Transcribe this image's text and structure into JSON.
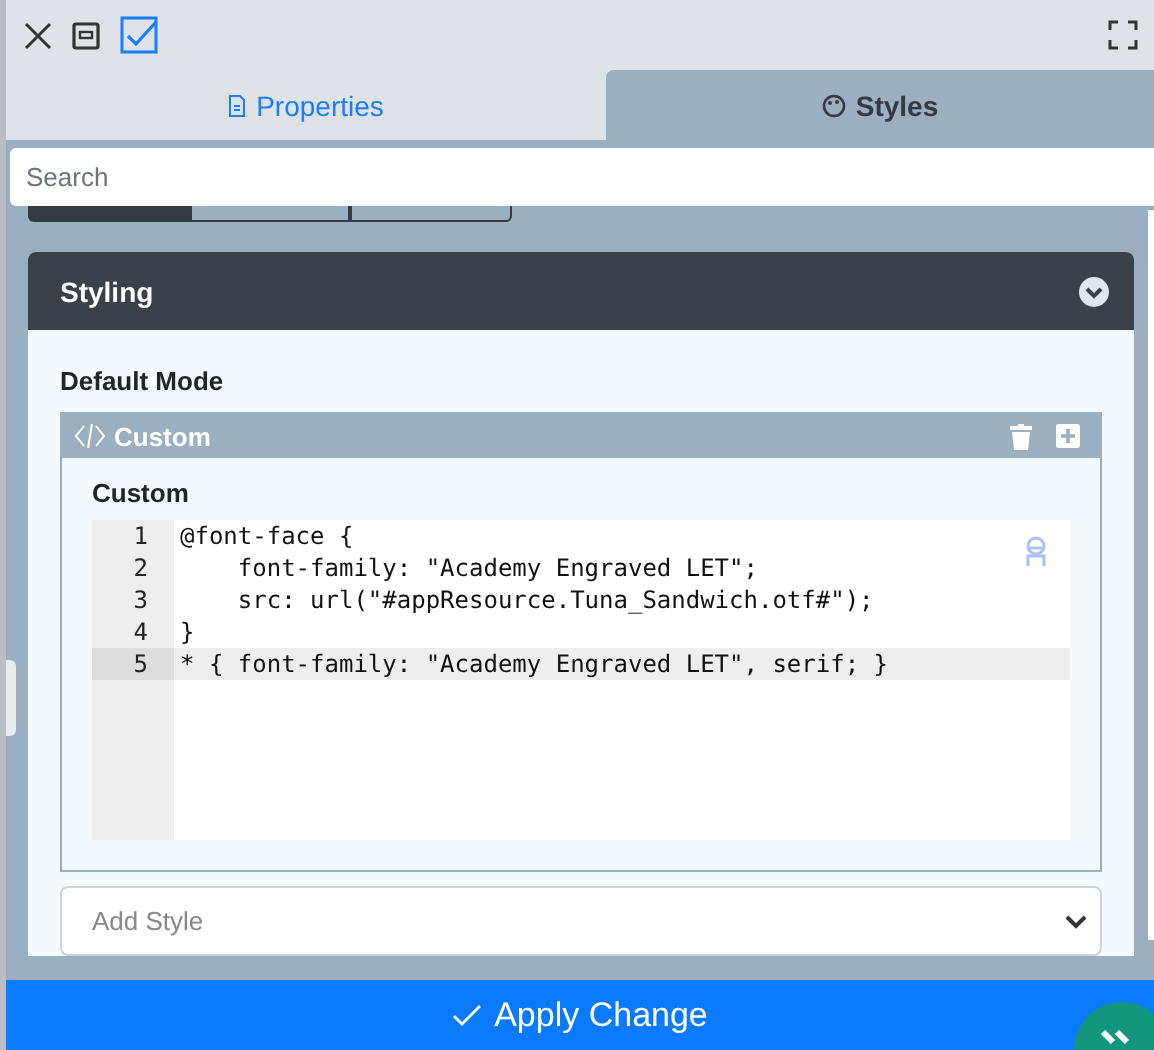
{
  "toolbar": {
    "checkbox_checked": true
  },
  "tabs": [
    {
      "label": "Properties",
      "selected": false
    },
    {
      "label": "Styles",
      "selected": true
    }
  ],
  "search": {
    "placeholder": "Search"
  },
  "segments": [
    {
      "selected": true
    },
    {
      "selected": false
    },
    {
      "selected": false
    }
  ],
  "section": {
    "title": "Styling",
    "expanded": true,
    "mode_label": "Default Mode",
    "style_block": {
      "title": "Custom",
      "field_label": "Custom",
      "lines": [
        {
          "number": "1",
          "code": "@font-face {",
          "active": false
        },
        {
          "number": "2",
          "code": "    font-family: \"Academy Engraved LET\";",
          "active": false
        },
        {
          "number": "3",
          "code": "    src: url(\"#appResource.Tuna_Sandwich.otf#\");",
          "active": false
        },
        {
          "number": "4",
          "code": "}",
          "active": false
        },
        {
          "number": "5",
          "code": "* { font-family: \"Academy Engraved LET\", serif; }",
          "active": true
        }
      ]
    },
    "add_style": {
      "placeholder": "Add Style"
    }
  },
  "apply_button": {
    "label": "Apply Change"
  }
}
